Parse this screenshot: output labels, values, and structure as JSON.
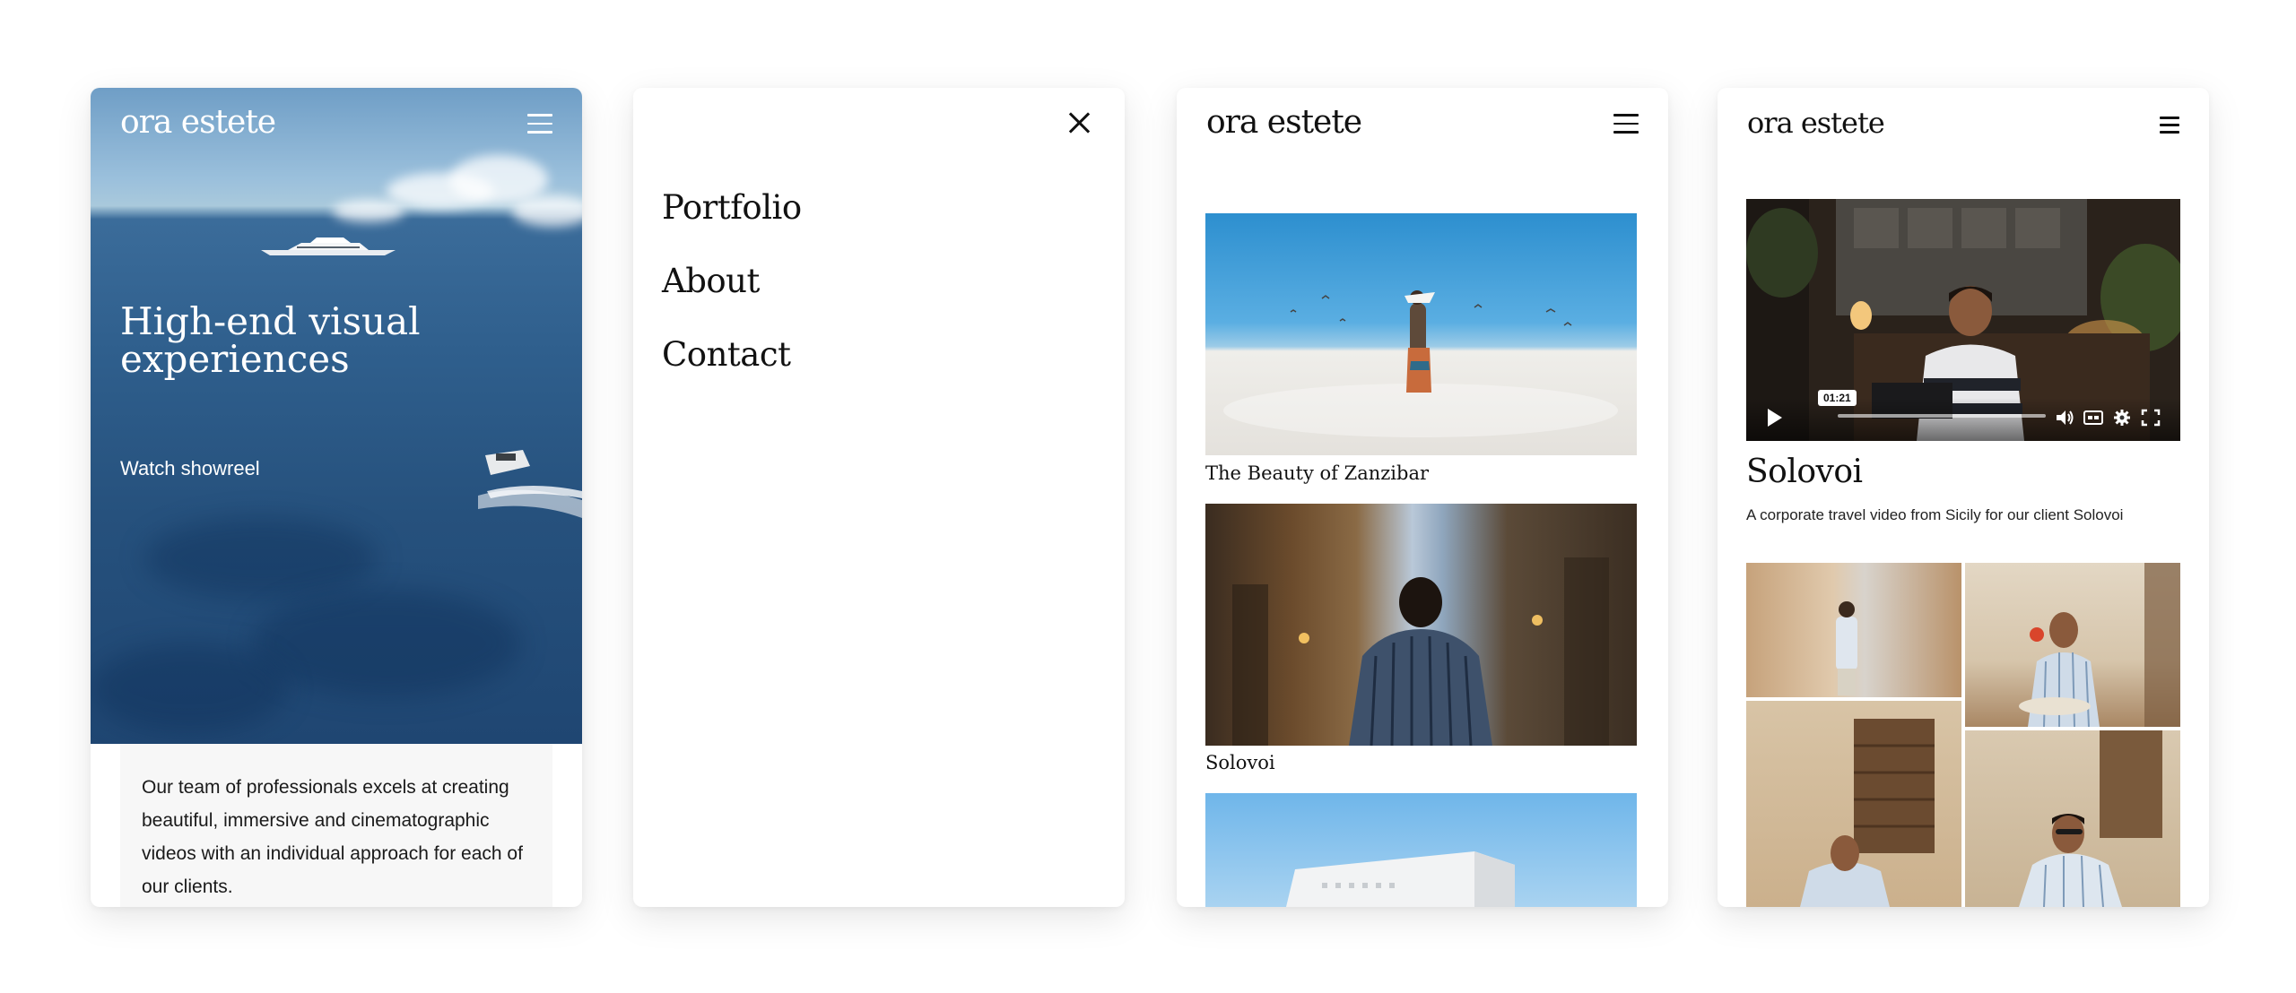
{
  "home": {
    "logo": "ora estete",
    "hero_title": "High-end visual experiences",
    "showreel_label": "Watch showreel",
    "intro_text": "Our team of professionals excels at creating beautiful, immersive and cinematographic videos with an individual approach for each of our clients."
  },
  "menu": {
    "items": [
      {
        "label": "Portfolio"
      },
      {
        "label": "About"
      },
      {
        "label": "Contact"
      }
    ]
  },
  "portfolio": {
    "logo": "ora estete",
    "projects": [
      {
        "title": "The Beauty of Zanzibar"
      },
      {
        "title": "Solovoi"
      }
    ]
  },
  "project": {
    "logo": "ora estete",
    "video_time": "01:21",
    "title": "Solovoi",
    "description": "A corporate travel video from Sicily for our client Solovoi"
  },
  "icons": {
    "menu": "hamburger-menu-icon",
    "close": "close-icon",
    "play": "play-icon",
    "volume": "volume-icon",
    "captions": "captions-icon",
    "settings": "gear-icon",
    "fullscreen": "fullscreen-icon"
  },
  "colors": {
    "text": "#111111",
    "background": "#ffffff",
    "intro_panel": "#f7f7f7"
  }
}
